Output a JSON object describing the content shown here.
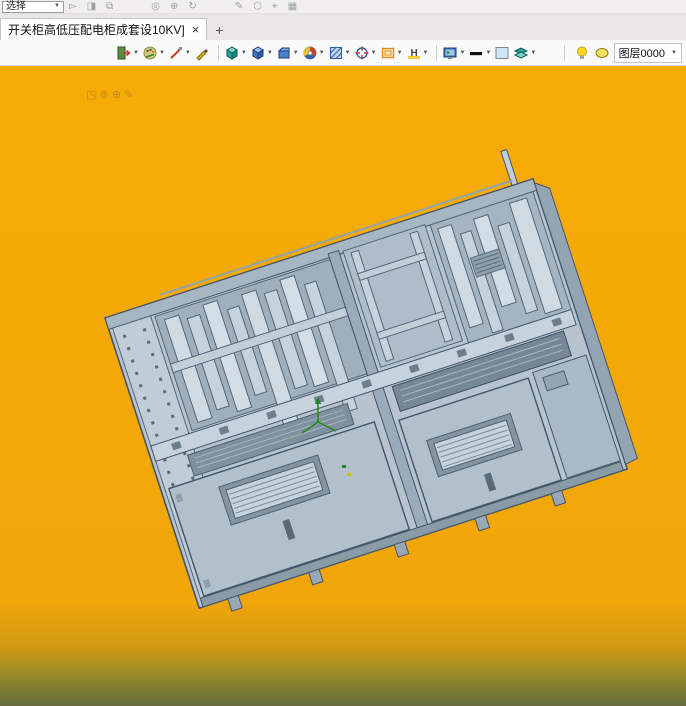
{
  "top_toolbar": {
    "select_label": "选择",
    "select_arrow": "▼",
    "icons": [
      {
        "name": "cursor-icon",
        "glyph": "▻"
      },
      {
        "name": "stamp-icon",
        "glyph": "◨"
      },
      {
        "name": "clone-icon",
        "glyph": "⧉"
      },
      {
        "name": "orbit-icon",
        "glyph": "◎"
      },
      {
        "name": "zoom-icon",
        "glyph": "⊕"
      },
      {
        "name": "rotate-icon",
        "glyph": "↻"
      },
      {
        "name": "sketch-icon",
        "glyph": "✎"
      },
      {
        "name": "polygon-icon",
        "glyph": "⬡"
      },
      {
        "name": "axis-icon",
        "glyph": "⌖"
      },
      {
        "name": "grid-icon",
        "glyph": "▦"
      }
    ]
  },
  "tab_bar": {
    "active_tab_title": "开关柜高低压配电柜成套设10KV]",
    "close_glyph": "×",
    "new_tab_glyph": "+"
  },
  "main_toolbar": {
    "dropdown_glyph": "▼",
    "icon_names": [
      "import-export",
      "palette",
      "brush",
      "pen",
      "solid-cube",
      "assembly-cube",
      "part-box",
      "color-wheel",
      "hatch-pattern",
      "origin-target",
      "viewport-frame",
      "dimension",
      "render-view",
      "line-width",
      "color-swatch",
      "layer-stack",
      "layer-visibility-bulb",
      "ellipse-tool"
    ],
    "layer_controls": {
      "layer_label": "图层0000",
      "dropdown_glyph": "▼"
    }
  },
  "canvas": {
    "colors": {
      "background_top": "#f6ab06",
      "background_bottom": "#666b3d",
      "model_fill": "#b7c4d0",
      "model_panel_light": "#cfdae2",
      "model_recess": "#8494a1",
      "model_stroke": "#44566a",
      "axis_triad_green": "#1e8a1e"
    }
  }
}
